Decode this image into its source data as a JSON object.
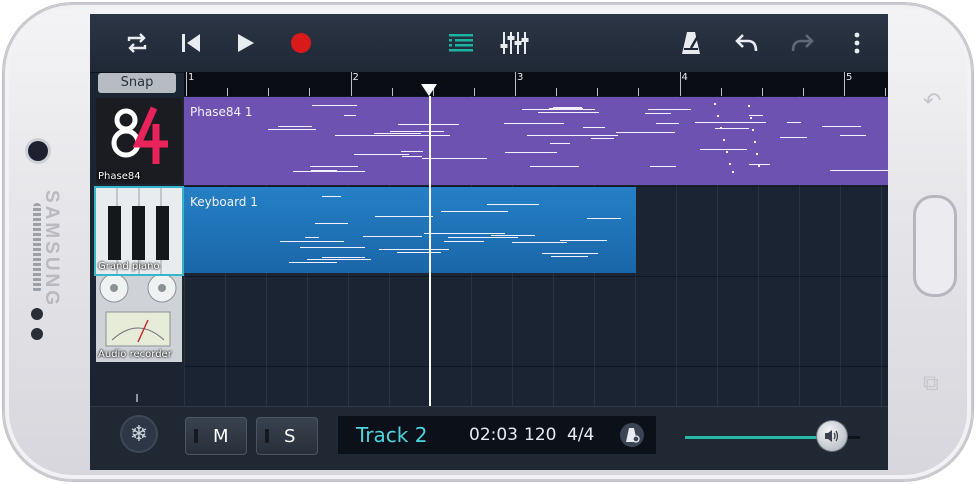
{
  "device": {
    "brand": "SAMSUNG"
  },
  "toolbar": {
    "icons": [
      "loop-icon",
      "skip-to-start-icon",
      "play-icon",
      "record-icon",
      "track-list-icon",
      "mixer-icon",
      "metronome-icon",
      "undo-icon",
      "redo-icon",
      "more-options-icon"
    ],
    "accent": "#19b5a1",
    "record_color": "#d81a1a"
  },
  "snap": {
    "label": "Snap"
  },
  "ruler": {
    "bars": [
      "1",
      "2",
      "3",
      "4",
      "5"
    ]
  },
  "tracks": [
    {
      "name": "Phase84",
      "region_label": "Phase84 1",
      "color": "#6d52b2"
    },
    {
      "name": "Grand piano",
      "region_label": "Keyboard 1",
      "color": "#1f73b8"
    },
    {
      "name": "Audio recorder"
    }
  ],
  "transport": {
    "mute_label": "M",
    "solo_label": "S",
    "track_name": "Track 2",
    "time": "02:03",
    "tempo": "120",
    "signature": "4/4"
  },
  "volume": {
    "level": 0.84
  }
}
